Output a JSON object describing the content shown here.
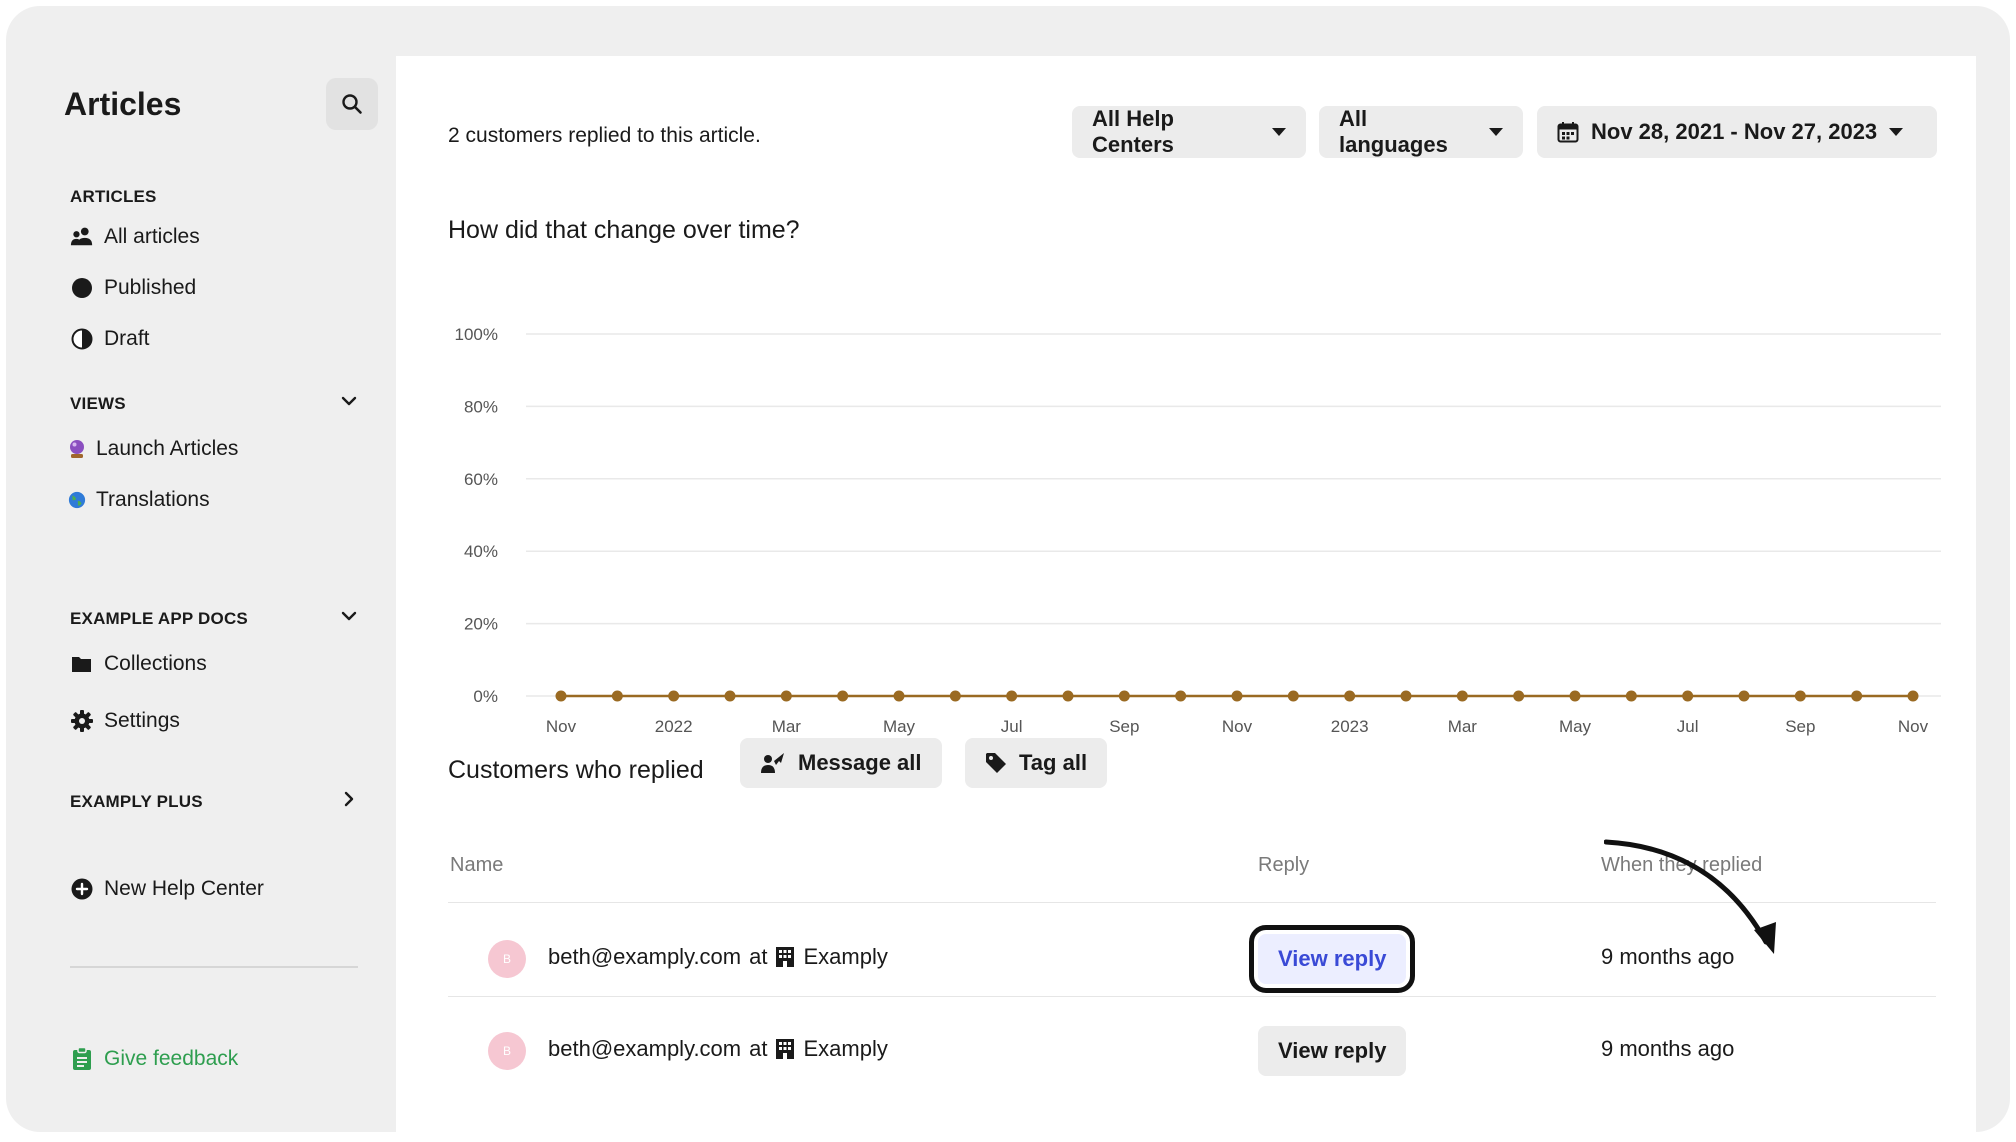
{
  "sidebar": {
    "title": "Articles",
    "sections": {
      "articles": "ARTICLES",
      "views": "VIEWS",
      "docs": "EXAMPLE APP DOCS",
      "plus": "EXAMPLY PLUS"
    },
    "items": {
      "all_articles": "All articles",
      "published": "Published",
      "draft": "Draft",
      "launch_articles": "Launch Articles",
      "translations": "Translations",
      "collections": "Collections",
      "settings": "Settings",
      "new_help_center": "New Help Center",
      "give_feedback": "Give feedback"
    }
  },
  "main": {
    "summary": "2 customers replied to this article.",
    "filters": {
      "help_centers": "All Help Centers",
      "languages": "All languages",
      "date_range": "Nov 28, 2021 - Nov 27, 2023"
    },
    "chart_title": "How did that change over time?",
    "customers_title": "Customers who replied",
    "message_all": "Message all",
    "tag_all": "Tag all",
    "table": {
      "headers": {
        "name": "Name",
        "reply": "Reply",
        "when": "When they replied"
      },
      "rows": [
        {
          "avatar": "B",
          "email": "beth@examply.com",
          "at": "at",
          "company": "Examply",
          "reply": "View reply",
          "when": "9 months ago",
          "highlighted": true
        },
        {
          "avatar": "B",
          "email": "beth@examply.com",
          "at": "at",
          "company": "Examply",
          "reply": "View reply",
          "when": "9 months ago",
          "highlighted": false
        }
      ]
    }
  },
  "chart_data": {
    "type": "line",
    "title": "How did that change over time?",
    "xlabel": "",
    "ylabel": "",
    "x_ticks": [
      "Nov",
      "2022",
      "Mar",
      "May",
      "Jul",
      "Sep",
      "Nov",
      "2023",
      "Mar",
      "May",
      "Jul",
      "Sep",
      "Nov"
    ],
    "y_ticks": [
      "0%",
      "20%",
      "40%",
      "60%",
      "80%",
      "100%"
    ],
    "ylim": [
      0,
      100
    ],
    "grid": true,
    "line_color": "#9a6a22",
    "series": [
      {
        "values": [
          0,
          0,
          0,
          0,
          0,
          0,
          0,
          0,
          0,
          0,
          0,
          0,
          0,
          0,
          0,
          0,
          0,
          0,
          0,
          0,
          0,
          0,
          0,
          0,
          0
        ]
      }
    ]
  },
  "colors": {
    "accent_link": "#3a4ad6",
    "feedback_green": "#2e9e4f",
    "chart_line": "#9a6a22"
  }
}
